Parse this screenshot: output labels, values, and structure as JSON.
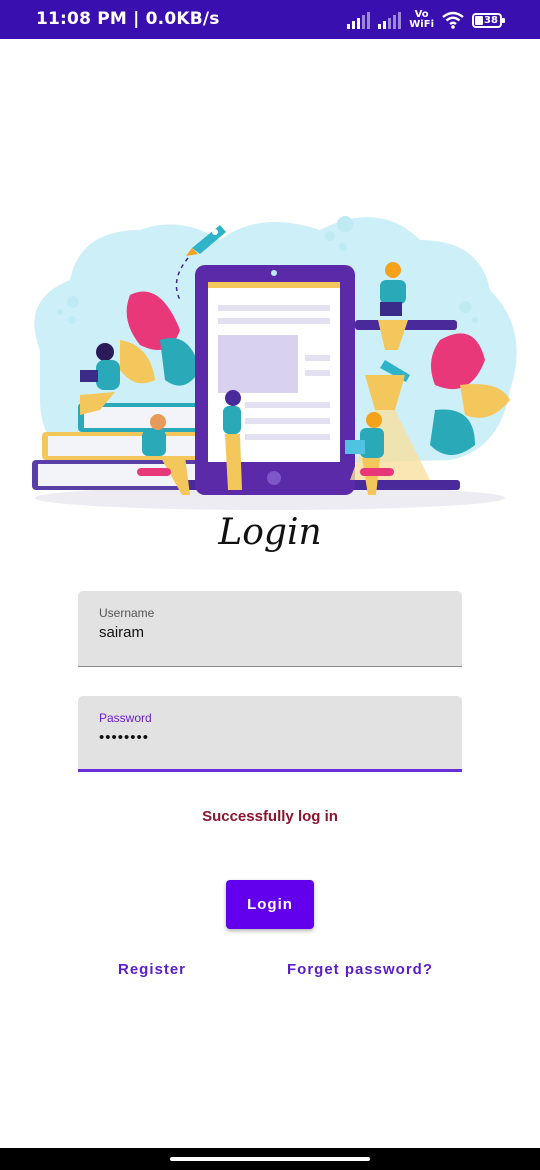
{
  "status_bar": {
    "time": "11:08 PM | 0.0KB/s",
    "vowifi_top": "Vo",
    "vowifi_bottom": "WiFi",
    "battery": "38",
    "icons": [
      "signal-icon",
      "signal-icon",
      "vowifi-icon",
      "wifi-icon",
      "battery-icon"
    ]
  },
  "screen": {
    "title": "Login",
    "username": {
      "label": "Username",
      "value": "sairam"
    },
    "password": {
      "label": "Password",
      "value": "••••••••"
    },
    "message": "Successfully log in",
    "login_button": "Login",
    "register_link": "Register",
    "forget_link": "Forget password?"
  },
  "colors": {
    "status_bar": "#3a0fb0",
    "accent": "#6200ee",
    "message": "#8b1530",
    "link": "#5a1fc8"
  }
}
